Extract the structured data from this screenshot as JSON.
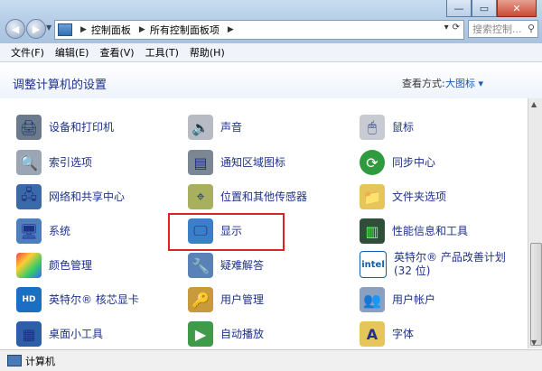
{
  "breadcrumbs": [
    "控制面板",
    "所有控制面板项"
  ],
  "search_placeholder": "搜索控制...",
  "menu": [
    "文件(F)",
    "编辑(E)",
    "查看(V)",
    "工具(T)",
    "帮助(H)"
  ],
  "header": {
    "title": "调整计算机的设置",
    "view_by_label": "查看方式:",
    "view_by_value": "大图标 ▾"
  },
  "items": [
    {
      "label": "设备和打印机",
      "icon": "printer-icon"
    },
    {
      "label": "声音",
      "icon": "speaker-icon"
    },
    {
      "label": "鼠标",
      "icon": "mouse-icon"
    },
    {
      "label": "索引选项",
      "icon": "magnifier-icon"
    },
    {
      "label": "通知区域图标",
      "icon": "taskbar-icon"
    },
    {
      "label": "同步中心",
      "icon": "sync-icon"
    },
    {
      "label": "网络和共享中心",
      "icon": "network-icon"
    },
    {
      "label": "位置和其他传感器",
      "icon": "sensor-icon"
    },
    {
      "label": "文件夹选项",
      "icon": "folder-icon"
    },
    {
      "label": "系统",
      "icon": "computer-icon"
    },
    {
      "label": "显示",
      "icon": "monitor-icon"
    },
    {
      "label": "性能信息和工具",
      "icon": "performance-icon"
    },
    {
      "label": "颜色管理",
      "icon": "color-icon"
    },
    {
      "label": "疑难解答",
      "icon": "troubleshoot-icon"
    },
    {
      "label": "英特尔® 产品改善计划",
      "label2": "(32 位)",
      "icon": "intel-icon"
    },
    {
      "label": "英特尔® 核芯显卡",
      "icon": "intel-graphics-icon"
    },
    {
      "label": "用户管理",
      "icon": "user-key-icon"
    },
    {
      "label": "用户帐户",
      "icon": "users-icon"
    },
    {
      "label": "桌面小工具",
      "icon": "gadgets-icon"
    },
    {
      "label": "自动播放",
      "icon": "autoplay-icon"
    },
    {
      "label": "字体",
      "icon": "font-icon"
    }
  ],
  "status": "计算机"
}
